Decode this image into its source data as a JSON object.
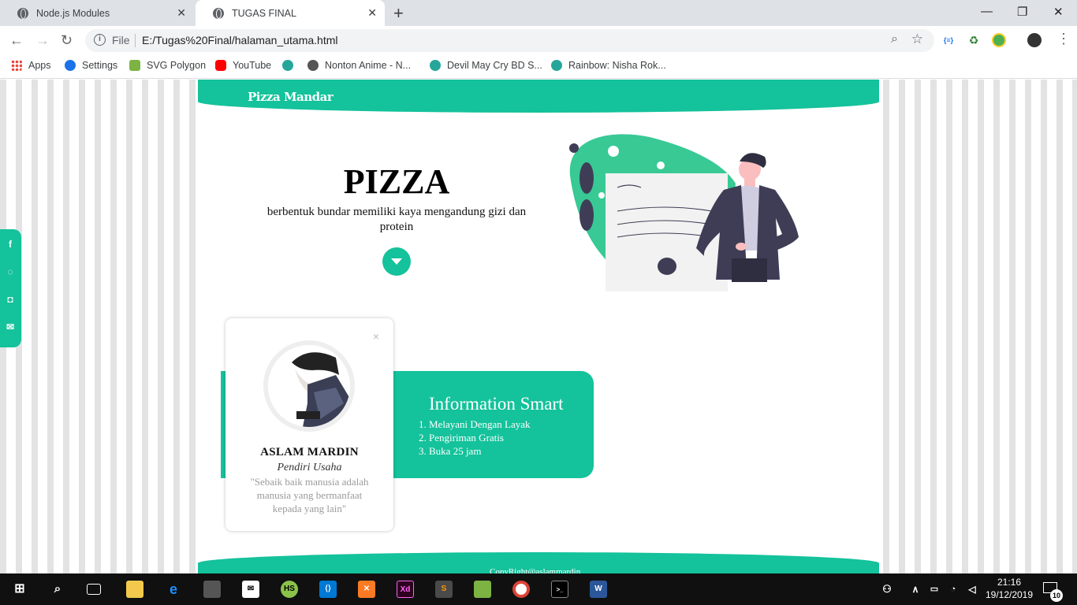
{
  "browser": {
    "tabs": [
      {
        "label": "Node.js Modules",
        "active": false
      },
      {
        "label": "TUGAS FINAL",
        "active": true
      }
    ],
    "address": {
      "scheme_label": "File",
      "url": "E:/Tugas%20Final/halaman_utama.html"
    },
    "bookmarks": [
      {
        "label": "Apps",
        "icon": "apps-grid-icon"
      },
      {
        "label": "Settings",
        "icon": "gear-icon"
      },
      {
        "label": "SVG Polygon",
        "icon": "svg-polygon-icon"
      },
      {
        "label": "YouTube",
        "icon": "youtube-icon"
      },
      {
        "label": "",
        "icon": "swirl-icon"
      },
      {
        "label": "Nonton Anime - N...",
        "icon": "anime-icon"
      },
      {
        "label": "Devil May Cry BD S...",
        "icon": "swirl-icon"
      },
      {
        "label": "Rainbow: Nisha Rok...",
        "icon": "swirl-icon"
      }
    ]
  },
  "site": {
    "brand": "Pizza Mandar",
    "hero": {
      "title": "PIZZA",
      "subtitle": "berbentuk bundar memiliki kaya mengandung gizi dan protein"
    },
    "profile": {
      "name": "ASLAM MARDIN",
      "role": "Pendiri Usaha",
      "quote": "\"Sebaik baik manusia adalah manusia yang bermanfaat kepada yang lain\"",
      "close": "×"
    },
    "info": {
      "title": "Information Smart",
      "items": [
        "1. Melayani Dengan Layak",
        "2. Pengiriman Gratis",
        "3. Buka 25 jam"
      ]
    },
    "footer": {
      "copyright": "CopyRight@aslammardin"
    },
    "social": [
      "facebook-icon",
      "whatsapp-icon",
      "instagram-icon",
      "email-icon"
    ],
    "colors": {
      "accent": "#14c29b",
      "dark": "#3f3d56"
    }
  },
  "taskbar": {
    "time": "21:16",
    "date": "19/12/2019",
    "notifications": "10"
  }
}
